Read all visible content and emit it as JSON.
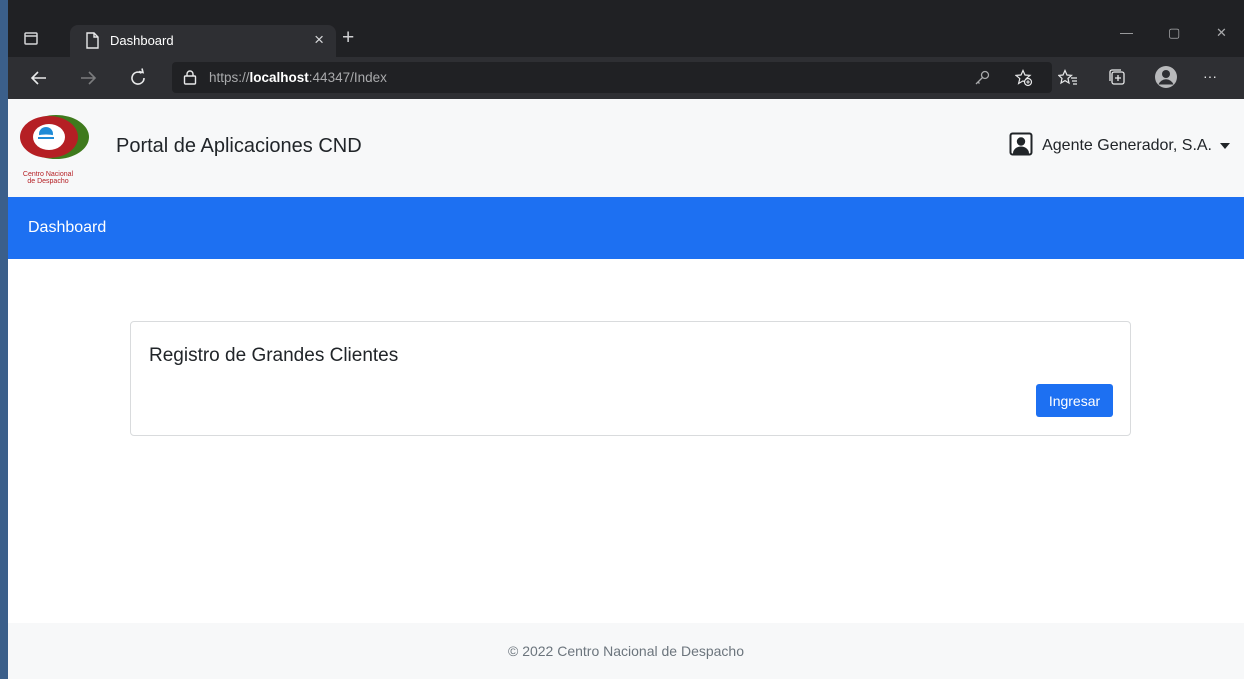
{
  "browser": {
    "tab_title": "Dashboard",
    "tab_close": "×",
    "new_tab": "+",
    "url_scheme": "https://",
    "url_host": "localhost",
    "url_rest": ":44347/Index",
    "window_controls": {
      "minimize": "—",
      "maximize": "▢",
      "close": "✕"
    },
    "more": "···"
  },
  "header": {
    "brand": "Portal de Aplicaciones CND",
    "user": "Agente Generador, S.A.",
    "logo_text": [
      "Centro Nacional",
      "de Despacho"
    ]
  },
  "nav": {
    "dashboard_link": "Dashboard"
  },
  "card": {
    "title": "Registro de Grandes Clientes",
    "button": "Ingresar"
  },
  "footer": {
    "text": "© 2022 Centro Nacional de Despacho"
  },
  "colors": {
    "primary": "#1d70f2",
    "navbar_bg": "#f7f8f9",
    "chrome_dark": "#202124",
    "logo_red": "#b51f24",
    "logo_green": "#3f7a1d",
    "logo_blue": "#1f8bd6"
  }
}
